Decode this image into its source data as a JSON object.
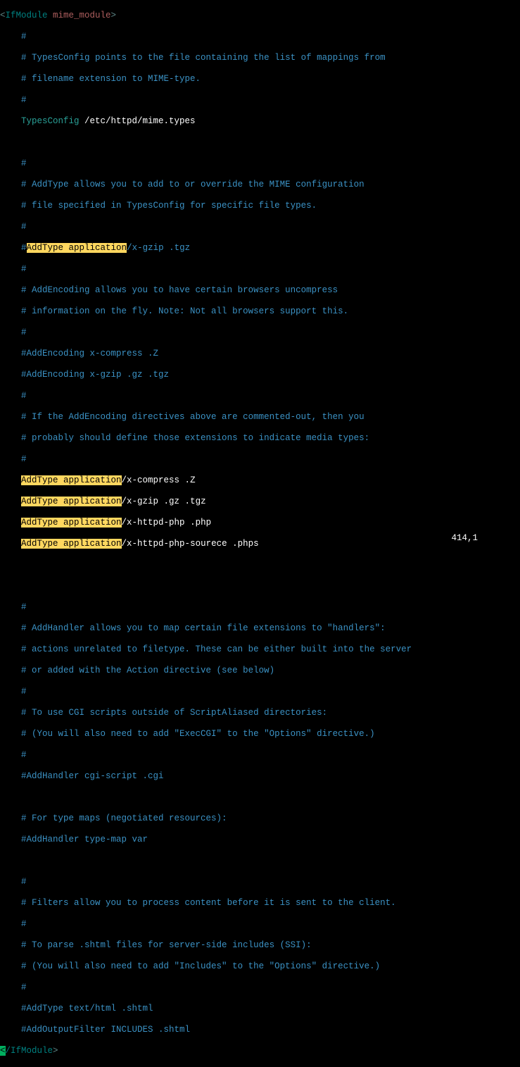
{
  "ifmodule_open_bracket": "<",
  "ifmodule_open_tag": "IfModule",
  "ifmodule_module": " mime_module",
  "ifmodule_open_close": ">",
  "ifmodule_close_cursor": "<",
  "ifmodule_close_tag": "/IfModule",
  "ifmodule_close_bracket": ">",
  "indent": "    ",
  "c1": "#",
  "c2": "# TypesConfig points to the file containing the list of mappings from",
  "c3": "# filename extension to MIME-type.",
  "c4": "#",
  "d_typesconfig": "TypesConfig",
  "v_typesconfig": " /etc/httpd/mime.types",
  "c5": "#",
  "c6": "# AddType allows you to add to or override the MIME configuration",
  "c7": "# file specified in TypesConfig for specific file types.",
  "c8": "#",
  "c9_hash": "#",
  "hl_addtype_app": "AddType application",
  "c9_rest": "/x-gzip .tgz",
  "c10": "#",
  "c11": "# AddEncoding allows you to have certain browsers uncompress",
  "c12": "# information on the fly. Note: Not all browsers support this.",
  "c13": "#",
  "c14": "#AddEncoding x-compress .Z",
  "c15": "#AddEncoding x-gzip .gz .tgz",
  "c16": "#",
  "c17": "# If the AddEncoding directives above are commented-out, then you",
  "c18": "# probably should define those extensions to indicate media types:",
  "c19": "#",
  "at1_rest": "/x-compress .Z",
  "at2_rest": "/x-gzip .gz .tgz",
  "at3_rest": "/x-httpd-php .php",
  "at4_rest": "/x-httpd-php-sourece .phps",
  "c20": "#",
  "c21": "# AddHandler allows you to map certain file extensions to \"handlers\":",
  "c22": "# actions unrelated to filetype. These can be either built into the server",
  "c23": "# or added with the Action directive (see below)",
  "c24": "#",
  "c25": "# To use CGI scripts outside of ScriptAliased directories:",
  "c26": "# (You will also need to add \"ExecCGI\" to the \"Options\" directive.)",
  "c27": "#",
  "c28": "#AddHandler cgi-script .cgi",
  "c29": "# For type maps (negotiated resources):",
  "c30": "#AddHandler type-map var",
  "c31": "#",
  "c32": "# Filters allow you to process content before it is sent to the client.",
  "c33": "#",
  "c34": "# To parse .shtml files for server-side includes (SSI):",
  "c35": "# (You will also need to add \"Includes\" to the \"Options\" directive.)",
  "c36": "#",
  "c37": "#AddType text/html .shtml",
  "c38": "#AddOutputFilter INCLUDES .shtml",
  "status_pos": "414,1"
}
